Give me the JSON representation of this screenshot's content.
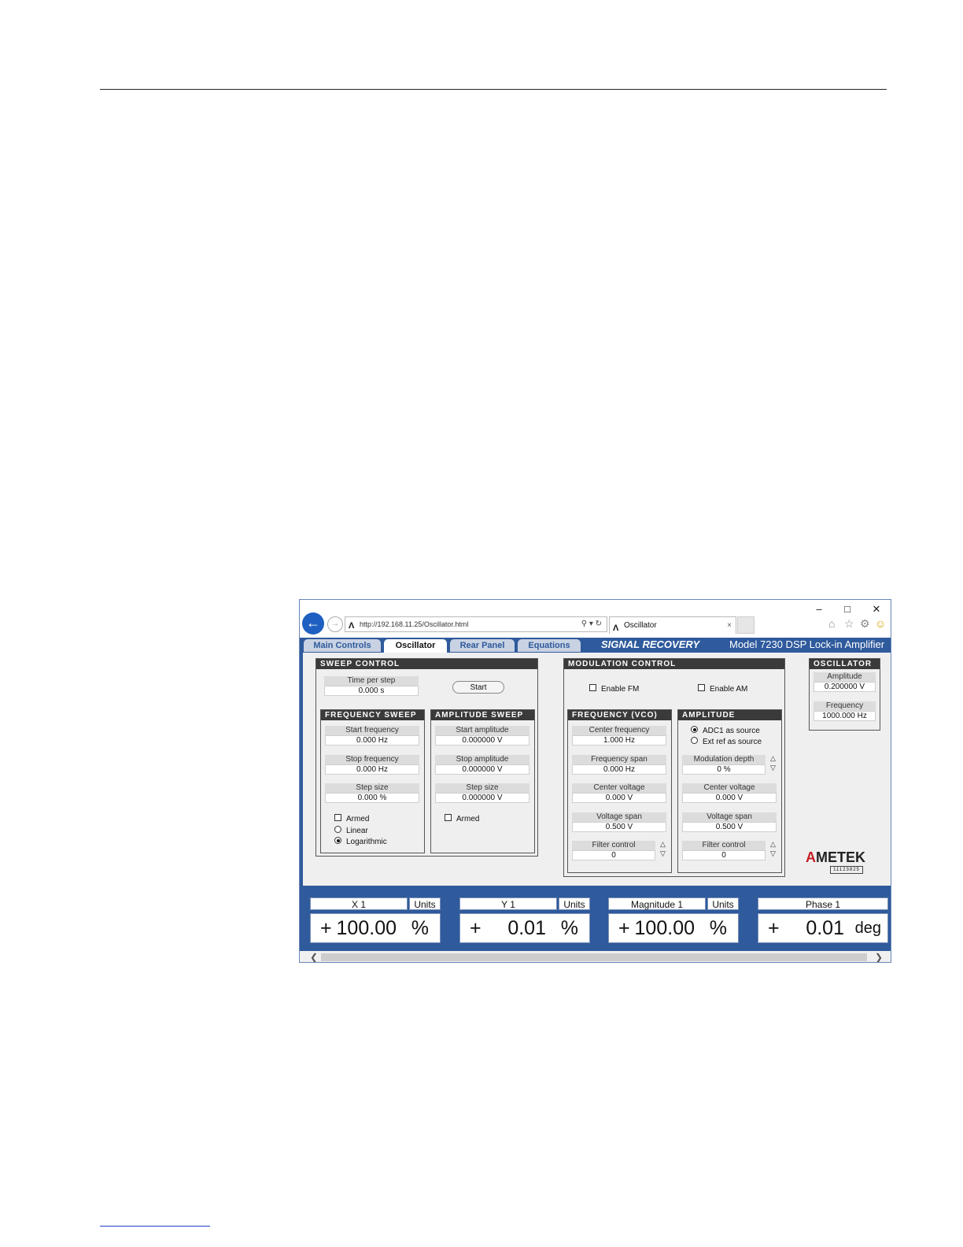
{
  "window": {
    "minimize": "–",
    "maximize": "□",
    "close": "✕",
    "url": "http://192.168.11.25/Oscillator.html",
    "tab_title": "Oscillator",
    "tab_close": "×"
  },
  "nav": {
    "tabs": [
      {
        "label": "Main Controls"
      },
      {
        "label": "Oscillator"
      },
      {
        "label": "Rear Panel"
      },
      {
        "label": "Equations"
      }
    ],
    "active": "Oscillator",
    "brand": "SIGNAL RECOVERY",
    "model": "Model 7230 DSP Lock-in Amplifier"
  },
  "sweep_control": {
    "title": "Sweep Control",
    "time_per_step": {
      "label": "Time per step",
      "value": "0.000 s"
    },
    "start_button": "Start",
    "frequency_sweep": {
      "title": "Frequency Sweep",
      "start": {
        "label": "Start frequency",
        "value": "0.000 Hz"
      },
      "stop": {
        "label": "Stop frequency",
        "value": "0.000 Hz"
      },
      "step": {
        "label": "Step size",
        "value": "0.000 %"
      },
      "armed": "Armed",
      "linear": "Linear",
      "logarithmic": "Logarithmic"
    },
    "amplitude_sweep": {
      "title": "Amplitude Sweep",
      "start": {
        "label": "Start amplitude",
        "value": "0.000000 V"
      },
      "stop": {
        "label": "Stop amplitude",
        "value": "0.000000 V"
      },
      "step": {
        "label": "Step size",
        "value": "0.000000 V"
      },
      "armed": "Armed"
    }
  },
  "modulation_control": {
    "title": "Modulation Control",
    "enable_fm": "Enable FM",
    "enable_am": "Enable AM",
    "frequency_vco": {
      "title": "Frequency (VCO)",
      "center_frequency": {
        "label": "Center frequency",
        "value": "1.000 Hz"
      },
      "frequency_span": {
        "label": "Frequency span",
        "value": "0.000 Hz"
      },
      "center_voltage": {
        "label": "Center voltage",
        "value": "0.000 V"
      },
      "voltage_span": {
        "label": "Voltage span",
        "value": "0.500 V"
      },
      "filter_control": {
        "label": "Filter control",
        "value": "0"
      }
    },
    "amplitude": {
      "title": "Amplitude",
      "adc1": "ADC1 as source",
      "ext_ref": "Ext ref as source",
      "modulation_depth": {
        "label": "Modulation depth",
        "value": "0 %"
      },
      "center_voltage": {
        "label": "Center voltage",
        "value": "0.000 V"
      },
      "voltage_span": {
        "label": "Voltage span",
        "value": "0.500 V"
      },
      "filter_control": {
        "label": "Filter control",
        "value": "0"
      }
    }
  },
  "oscillator": {
    "title": "Oscillator",
    "amplitude": {
      "label": "Amplitude",
      "value": "0.200000 V"
    },
    "frequency": {
      "label": "Frequency",
      "value": "1000.000 Hz"
    }
  },
  "logo": {
    "text": "METEK",
    "lead": "A",
    "serial": "11123825"
  },
  "readouts": [
    {
      "label": "X 1",
      "units_label": "Units",
      "sign": "+",
      "value": "100.00",
      "unit": "%"
    },
    {
      "label": "Y 1",
      "units_label": "Units",
      "sign": "+",
      "value": "0.01",
      "unit": "%"
    },
    {
      "label": "Magnitude 1",
      "units_label": "Units",
      "sign": "+",
      "value": "100.00",
      "unit": "%"
    },
    {
      "label": "Phase 1",
      "units_label": "",
      "sign": "+",
      "value": "0.01",
      "unit": "deg"
    }
  ],
  "colors": {
    "accent": "#2f5a9c",
    "brand_red": "#c51d24"
  }
}
